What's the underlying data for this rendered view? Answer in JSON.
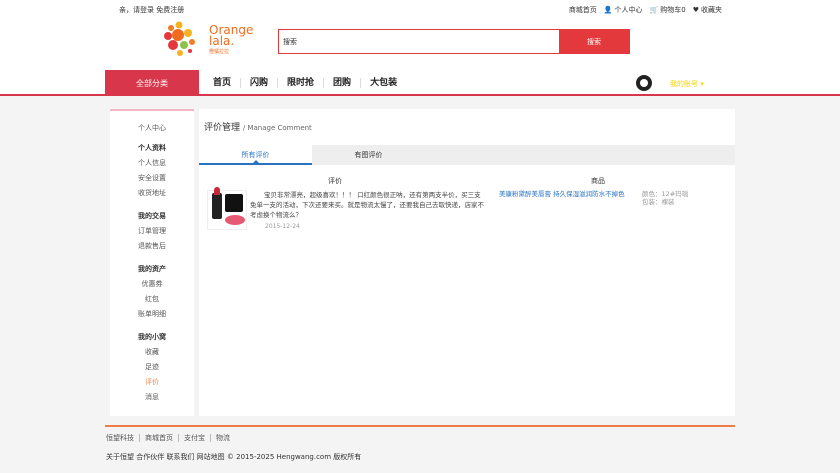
{
  "topbar": {
    "greeting": "亲，请登录 免费注册",
    "links": [
      "商城首页",
      "个人中心",
      "购物车0",
      "收藏夹"
    ]
  },
  "logo": {
    "text": "Orange lala.",
    "sub": "橙橘拉拉"
  },
  "search": {
    "value": "搜索",
    "button": "搜索"
  },
  "nav": {
    "all_categories": "全部分类",
    "links": [
      "首页",
      "闪购",
      "限时抢",
      "团购",
      "大包装"
    ],
    "username": "我的账号 ▾"
  },
  "sidebar": {
    "home": "个人中心",
    "groups": [
      {
        "title": "个人资料",
        "items": [
          "个人信息",
          "安全设置",
          "收货地址"
        ]
      },
      {
        "title": "我的交易",
        "items": [
          "订单管理",
          "退款售后"
        ]
      },
      {
        "title": "我的资产",
        "items": [
          "优惠券",
          "红包",
          "账单明细"
        ]
      },
      {
        "title": "我的小窝",
        "items": [
          "收藏",
          "足迹",
          "评价",
          "消息"
        ]
      }
    ],
    "active_item": "评价"
  },
  "page": {
    "title": "评价管理",
    "subtitle": "/ Manage Comment",
    "tabs": [
      "所有评价",
      "有图评价"
    ],
    "columns": [
      "评价",
      "商品"
    ]
  },
  "review": {
    "text": "宝贝非常漂亮，超级喜欢！！！ 口红颜色很正呐，还有第两支半价，买三支免单一支的活动，下次还要来买。就是物流太慢了，还要我自己去取快递，店家不考虑换个物流么？",
    "date": "2015-12-24",
    "product": "美康粉黛醉美唇膏 持久保湿滋润防水不掉色",
    "color": "颜色：12#玛瑙",
    "package": "包装：裸装"
  },
  "footer": {
    "links": [
      "恒望科技",
      "商城首页",
      "支付宝",
      "物流"
    ],
    "copyright": "关于恒望 合作伙伴 联系我们 网站地图 © 2015-2025 Hengwang.com 版权所有"
  },
  "colors": {
    "accent": "#d8364a",
    "brand": "#ef6c1e",
    "link": "#2a73c5"
  }
}
